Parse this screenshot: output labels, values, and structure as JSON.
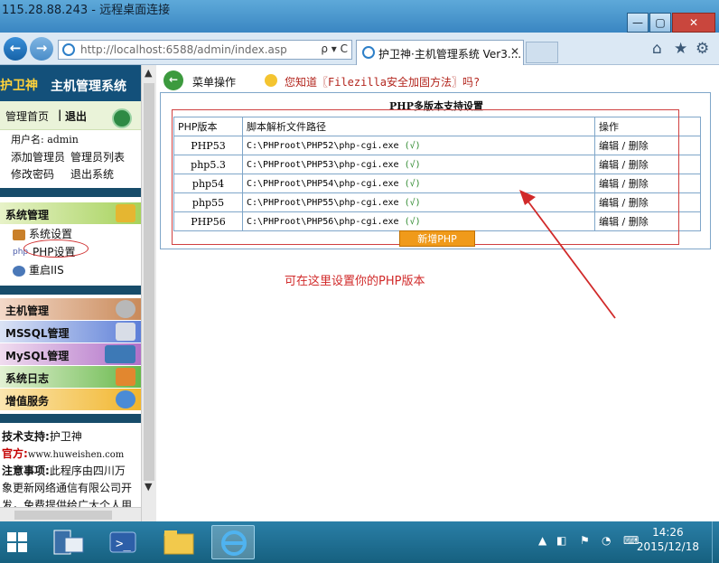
{
  "rdp": {
    "title": "115.28.88.243 - 远程桌面连接",
    "minimize": "—",
    "restore": "▢",
    "close": "✕"
  },
  "browser": {
    "back": "←",
    "forward": "→",
    "address": "http://localhost:6588/admin/index.asp",
    "address_tools": "ρ ▾ C",
    "tab_title": "护卫神·主机管理系统 Ver3....",
    "tab_close": "✕",
    "home": "⌂",
    "favorites": "★",
    "settings": "⚙"
  },
  "sidebar": {
    "brand_part1": "护卫神",
    "brand_part2": "主机管理系统",
    "nav_home": "管理首页",
    "nav_sep": "|",
    "nav_logout": "退出",
    "username": "用户名: admin",
    "add_admin": "添加管理员",
    "admin_list": "管理员列表",
    "change_password": "修改密码",
    "exit_system": "退出系统",
    "sections": {
      "system": "系统管理",
      "system_settings": "系统设置",
      "php_settings": "PHP设置",
      "restart_iis": "重启IIS",
      "host": "主机管理",
      "mssql": "MSSQL管理",
      "mysql": "MySQL管理",
      "logs": "系统日志",
      "value_added": "增值服务"
    },
    "support_label": "技术支持:",
    "support_value": "护卫神",
    "site_label": "官方:",
    "site_value": "www.huweishen.com",
    "notice_label": "注意事项:",
    "notice_text1": "此程序由四川万",
    "notice_text2": "象更新网络通信有限公司开",
    "notice_text3": "发，免费提供给广大个人用"
  },
  "main": {
    "menu_op": "菜单操作",
    "tip": "您知道〖Filezilla安全加固方法〗吗?",
    "panel_title": "PHP多版本支持设置",
    "headers": [
      "PHP版本",
      "脚本解析文件路径",
      "操作"
    ],
    "rows": [
      {
        "version": "PHP53",
        "path": "C:\\PHProot\\PHP52\\php-cgi.exe",
        "status": "(√)",
        "edit": "编辑",
        "sep": "/",
        "del": "删除"
      },
      {
        "version": "php5.3",
        "path": "C:\\PHProot\\PHP53\\php-cgi.exe",
        "status": "(√)",
        "edit": "编辑",
        "sep": "/",
        "del": "删除"
      },
      {
        "version": "php54",
        "path": "C:\\PHProot\\PHP54\\php-cgi.exe",
        "status": "(√)",
        "edit": "编辑",
        "sep": "/",
        "del": "删除"
      },
      {
        "version": "php55",
        "path": "C:\\PHProot\\PHP55\\php-cgi.exe",
        "status": "(√)",
        "edit": "编辑",
        "sep": "/",
        "del": "删除"
      },
      {
        "version": "PHP56",
        "path": "C:\\PHProot\\PHP56\\php-cgi.exe",
        "status": "(√)",
        "edit": "编辑",
        "sep": "/",
        "del": "删除"
      }
    ],
    "add_button": "新增PHP",
    "annotation": "可在这里设置你的PHP版本"
  },
  "taskbar": {
    "time": "14:26",
    "date": "2015/12/18"
  },
  "colors": {
    "accent": "#13507a",
    "note_red": "#d12a2a",
    "button_orange": "#f09a1a"
  }
}
